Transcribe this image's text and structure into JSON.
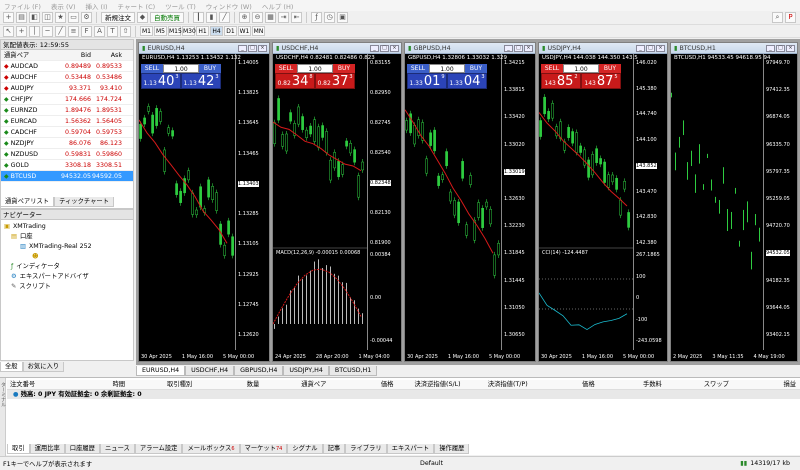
{
  "menu": [
    "ファイル (F)",
    "表示 (V)",
    "挿入 (I)",
    "チャート (C)",
    "ツール (T)",
    "ウィンドウ (W)",
    "ヘルプ (H)"
  ],
  "toolbar": {
    "new_order": "新規注文",
    "auto_trade": "自動売買"
  },
  "timeframes": [
    "M1",
    "M5",
    "M15",
    "M30",
    "H1",
    "H4",
    "D1",
    "W1",
    "MN"
  ],
  "market_watch": {
    "title": "気配値表示: 12:59:55",
    "headers": {
      "symbol": "通貨ペア",
      "bid": "Bid",
      "ask": "Ask"
    },
    "rows": [
      {
        "symbol": "AUDCAD",
        "bid": "0.89489",
        "ask": "0.89533",
        "dir": "down"
      },
      {
        "symbol": "AUDCHF",
        "bid": "0.53448",
        "ask": "0.53486",
        "dir": "down"
      },
      {
        "symbol": "AUDJPY",
        "bid": "93.371",
        "ask": "93.410",
        "dir": "down"
      },
      {
        "symbol": "CHFJPY",
        "bid": "174.666",
        "ask": "174.724",
        "dir": "up"
      },
      {
        "symbol": "EURNZD",
        "bid": "1.89476",
        "ask": "1.89531",
        "dir": "up"
      },
      {
        "symbol": "EURCAD",
        "bid": "1.56362",
        "ask": "1.56405",
        "dir": "up"
      },
      {
        "symbol": "CADCHF",
        "bid": "0.59704",
        "ask": "0.59753",
        "dir": "up"
      },
      {
        "symbol": "NZDJPY",
        "bid": "86.076",
        "ask": "86.123",
        "dir": "up"
      },
      {
        "symbol": "NZDUSD",
        "bid": "0.59831",
        "ask": "0.59860",
        "dir": "up"
      },
      {
        "symbol": "GOLD",
        "bid": "3308.18",
        "ask": "3308.51",
        "dir": "up"
      },
      {
        "symbol": "BTCUSD",
        "bid": "94532.05",
        "ask": "94592.05",
        "dir": "up",
        "selected": true
      }
    ],
    "tabs": [
      "通貨ペアリスト",
      "ティックチャート"
    ]
  },
  "navigator": {
    "title": "ナビゲーター",
    "items": [
      "XMTrading",
      "口座",
      "XMTrading-Real 252",
      "インディケータ",
      "エキスパートアドバイザ",
      "スクリプト"
    ],
    "tabs": [
      "全般",
      "お気に入り"
    ]
  },
  "charts": [
    {
      "title": "EURUSD,H4",
      "info": "EURUSD,H4 1.13253 1.13432 1.132",
      "style": "blue",
      "lot": "1.00",
      "sell": {
        "small": "1.13",
        "big": "40",
        "sup": "3"
      },
      "buy": {
        "small": "1.13",
        "big": "42",
        "sup": "3"
      },
      "prices": [
        "1.14005",
        "1.13825",
        "1.13645",
        "1.13465",
        "1.13403",
        "1.13285",
        "1.13105",
        "1.12925",
        "1.12745",
        "1.12620"
      ],
      "tag": "1.13403",
      "dates": [
        "30 Apr 2025",
        "1 May 16:00",
        "5 May 00:00"
      ]
    },
    {
      "title": "USDCHF,H4",
      "info": "USDCHF,H4 0.82481 0.82486 0.823",
      "style": "red",
      "lot": "1.00",
      "sell": {
        "small": "0.82",
        "big": "34",
        "sup": "8"
      },
      "buy": {
        "small": "0.82",
        "big": "37",
        "sup": "3"
      },
      "prices": [
        "0.83155",
        "0.82950",
        "0.82745",
        "0.82540",
        "0.82348",
        "0.82130",
        "0.81900"
      ],
      "tag": "0.82348",
      "macd": "MACD(12,26,9) -0.00015 0.00068",
      "macd_vals": [
        "0.00384",
        "0.00",
        "-0.00044"
      ],
      "dates": [
        "24 Apr 2025",
        "28 Apr 20:00",
        "1 May 04:00"
      ]
    },
    {
      "title": "GBPUSD,H4",
      "info": "GBPUSD,H4 1.32806 1.33032 1.329",
      "style": "blue",
      "lot": "1.00",
      "sell": {
        "small": "1.33",
        "big": "01",
        "sup": "9"
      },
      "buy": {
        "small": "1.33",
        "big": "04",
        "sup": "3"
      },
      "prices": [
        "1.34215",
        "1.33815",
        "1.33420",
        "1.33020",
        "1.33019",
        "1.32630",
        "1.32230",
        "1.31845",
        "1.31445",
        "1.31050",
        "1.30650"
      ],
      "tag": "1.33019",
      "dates": [
        "30 Apr 2025",
        "1 May 16:00",
        "5 May 00:00"
      ]
    },
    {
      "title": "USDJPY,H4",
      "info": "USDJPY,H4 144.038 144.350 143.5",
      "style": "red",
      "lot": "1.00",
      "sell": {
        "small": "143",
        "big": "85",
        "sup": "2"
      },
      "buy": {
        "small": "143",
        "big": "87",
        "sup": "5"
      },
      "prices": [
        "146.020",
        "145.380",
        "144.740",
        "144.100",
        "143.852",
        "143.470",
        "142.830",
        "142.380"
      ],
      "tag": "143.852",
      "cci": "CCI(14) -124.4487",
      "cci_vals": [
        "267.1865",
        "100",
        "0",
        "-100",
        "-243.0598"
      ],
      "dates": [
        "30 Apr 2025",
        "1 May 16:00",
        "5 May 00:00"
      ]
    },
    {
      "title": "BTCUSD,H1",
      "info": "BTCUSD,H1 94533.45 94618.95 94",
      "prices": [
        "97949.70",
        "97412.35",
        "96874.05",
        "96335.70",
        "95797.35",
        "95259.05",
        "94720.70",
        "94532.05",
        "94182.35",
        "93644.05",
        "93402.15"
      ],
      "tag": "94532.05",
      "dates": [
        "2 May 2025",
        "3 May 11:35",
        "4 May 19:00"
      ]
    }
  ],
  "chart_tabs": [
    "EURUSD,H4",
    "USDCHF,H4",
    "GBPUSD,H4",
    "USDJPY,H4",
    "BTCUSD,H1"
  ],
  "terminal": {
    "headers": [
      "注文番号",
      "時間",
      "取引種別",
      "数量",
      "通貨ペア",
      "価格",
      "決済逆指値(S/L)",
      "決済指値(T/P)",
      "価格",
      "手数料",
      "スワップ",
      "損益"
    ],
    "balance": "残高: 0 JPY  有効証拠金: 0  余剰証拠金: 0",
    "tabs": [
      {
        "label": "取引"
      },
      {
        "label": "運用比率"
      },
      {
        "label": "口座履歴"
      },
      {
        "label": "ニュース"
      },
      {
        "label": "アラーム設定"
      },
      {
        "label": "メールボックス",
        "badge": "6"
      },
      {
        "label": "マーケット",
        "badge": "74"
      },
      {
        "label": "シグナル"
      },
      {
        "label": "記事"
      },
      {
        "label": "ライブラリ"
      },
      {
        "label": "エキスパート"
      },
      {
        "label": "操作履歴"
      }
    ],
    "side_label": "ターミナル"
  },
  "status": {
    "help": "F1キーでヘルプが表示されます",
    "profile": "Default",
    "traffic": "14319/17 kb"
  }
}
